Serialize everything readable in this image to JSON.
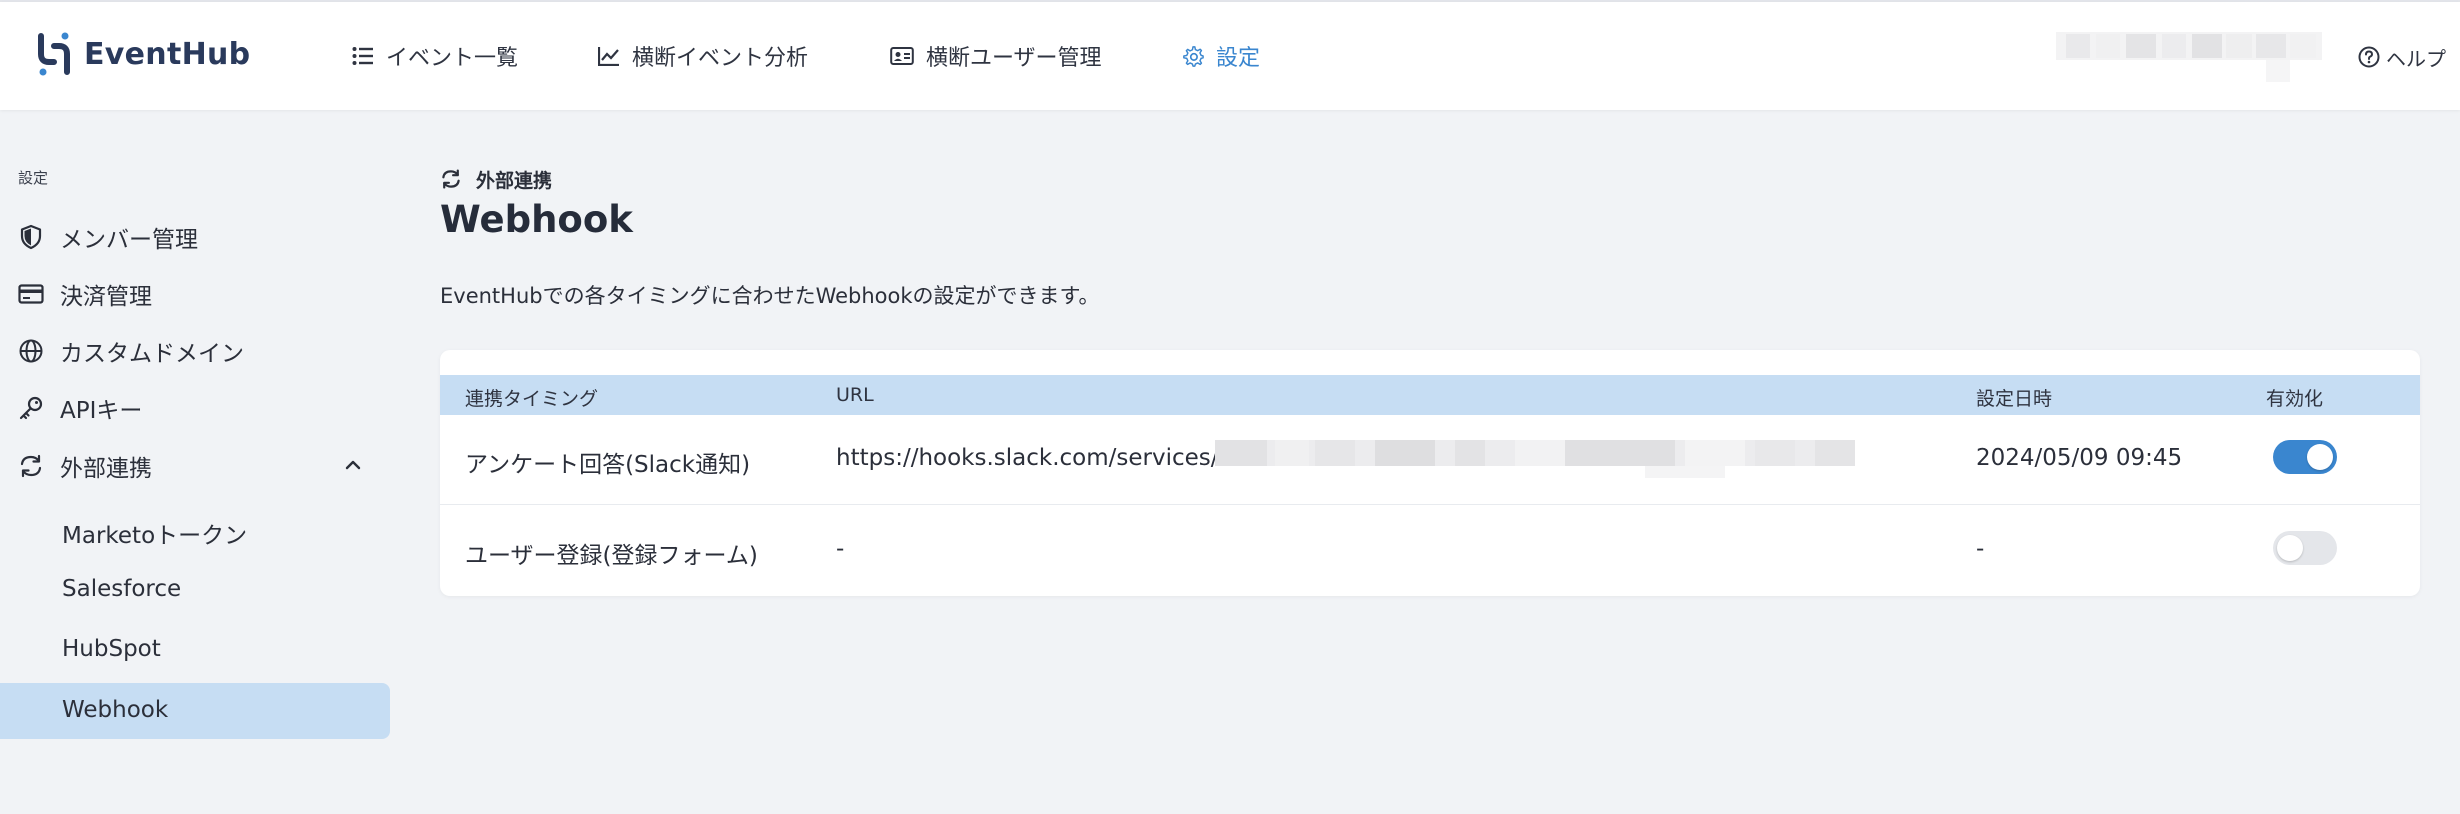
{
  "app": {
    "name": "EventHub",
    "brand_color": "#3a86cf",
    "logo_icon": "eventhub-logo-icon"
  },
  "header": {
    "nav": [
      {
        "label": "イベント一覧",
        "icon": "list-icon",
        "active": false
      },
      {
        "label": "横断イベント分析",
        "icon": "chart-line-icon",
        "active": false
      },
      {
        "label": "横断ユーザー管理",
        "icon": "id-card-icon",
        "active": false
      },
      {
        "label": "設定",
        "icon": "gear-icon",
        "active": true
      }
    ],
    "help_label": "ヘルプ",
    "help_icon": "question-circle-icon"
  },
  "sidebar": {
    "section_title": "設定",
    "items": [
      {
        "label": "メンバー管理",
        "icon": "shield-icon"
      },
      {
        "label": "決済管理",
        "icon": "credit-card-icon"
      },
      {
        "label": "カスタムドメイン",
        "icon": "globe-icon"
      },
      {
        "label": "APIキー",
        "icon": "key-icon"
      },
      {
        "label": "外部連携",
        "icon": "sync-icon",
        "expanded": true
      }
    ],
    "sub_items": [
      {
        "label": "Marketoトークン",
        "active": false
      },
      {
        "label": "Salesforce",
        "active": false
      },
      {
        "label": "HubSpot",
        "active": false
      },
      {
        "label": "Webhook",
        "active": true
      }
    ]
  },
  "main": {
    "breadcrumb": "外部連携",
    "title": "Webhook",
    "description": "EventHubでの各タイミングに合わせたWebhookの設定ができます。",
    "table": {
      "columns": [
        "連携タイミング",
        "URL",
        "設定日時",
        "有効化"
      ],
      "rows": [
        {
          "timing": "アンケート回答(Slack通知)",
          "url": "https://hooks.slack.com/services/",
          "url_masked": true,
          "datetime": "2024/05/09 09:45",
          "enabled": true
        },
        {
          "timing": "ユーザー登録(登録フォーム)",
          "url": "-",
          "url_masked": false,
          "datetime": "-",
          "enabled": false
        }
      ]
    }
  }
}
